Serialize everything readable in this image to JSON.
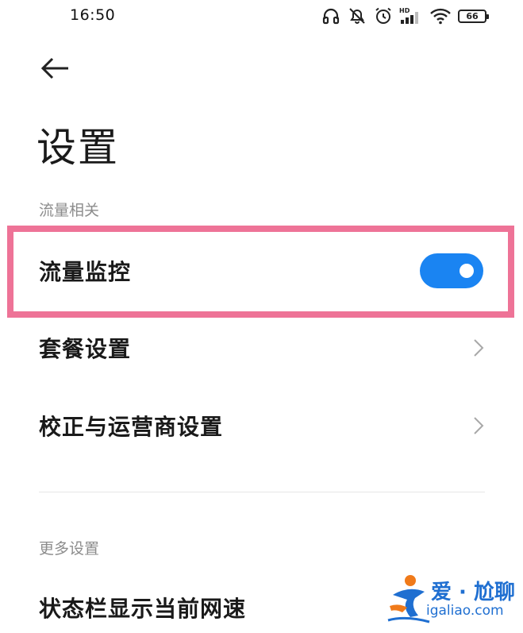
{
  "status_bar": {
    "time": "16:50",
    "icons": [
      "headphones-icon",
      "mute-icon",
      "alarm-icon",
      "hd-signal-icon",
      "wifi-icon"
    ],
    "hd_label": "HD",
    "battery_level": "66"
  },
  "header": {
    "back_icon": "arrow-left-icon",
    "title": "设置"
  },
  "sections": [
    {
      "header": "流量相关",
      "items": [
        {
          "label": "流量监控",
          "control": "toggle",
          "toggle_on": true,
          "highlighted": true
        },
        {
          "label": "套餐设置",
          "control": "chevron"
        },
        {
          "label": "校正与运营商设置",
          "control": "chevron"
        }
      ]
    },
    {
      "header": "更多设置",
      "items": [
        {
          "label": "状态栏显示当前网速"
        }
      ]
    }
  ],
  "colors": {
    "accent": "#1a84f2",
    "highlight_border": "#ee7397",
    "section_header": "#8c8c8c",
    "watermark": "#1f6fd1"
  },
  "watermark": {
    "text": "爱 · 尬聊",
    "url": "igaliao.com"
  }
}
